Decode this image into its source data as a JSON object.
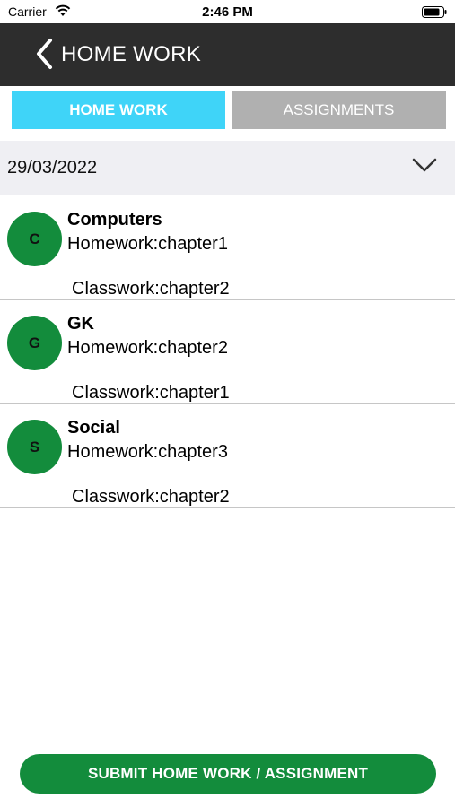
{
  "status_bar": {
    "carrier": "Carrier",
    "time": "2:46 PM"
  },
  "nav": {
    "title": "HOME WORK"
  },
  "tabs": [
    {
      "label": "HOME WORK",
      "selected": true
    },
    {
      "label": "ASSIGNMENTS",
      "selected": false
    }
  ],
  "date": {
    "value": "29/03/2022"
  },
  "items": [
    {
      "initial": "C",
      "subject": "Computers",
      "homework": "Homework:chapter1",
      "classwork": "Classwork:chapter2"
    },
    {
      "initial": "G",
      "subject": "GK",
      "homework": "Homework:chapter2",
      "classwork": "Classwork:chapter1"
    },
    {
      "initial": "S",
      "subject": "Social",
      "homework": "Homework:chapter3",
      "classwork": "Classwork:chapter2"
    }
  ],
  "submit": {
    "label": "SUBMIT HOME WORK / ASSIGNMENT"
  },
  "colors": {
    "nav_bg": "#2d2d2d",
    "tab_active": "#3fd4f8",
    "tab_inactive": "#b0b0b0",
    "avatar": "#138c3c",
    "submit": "#138c3c"
  }
}
